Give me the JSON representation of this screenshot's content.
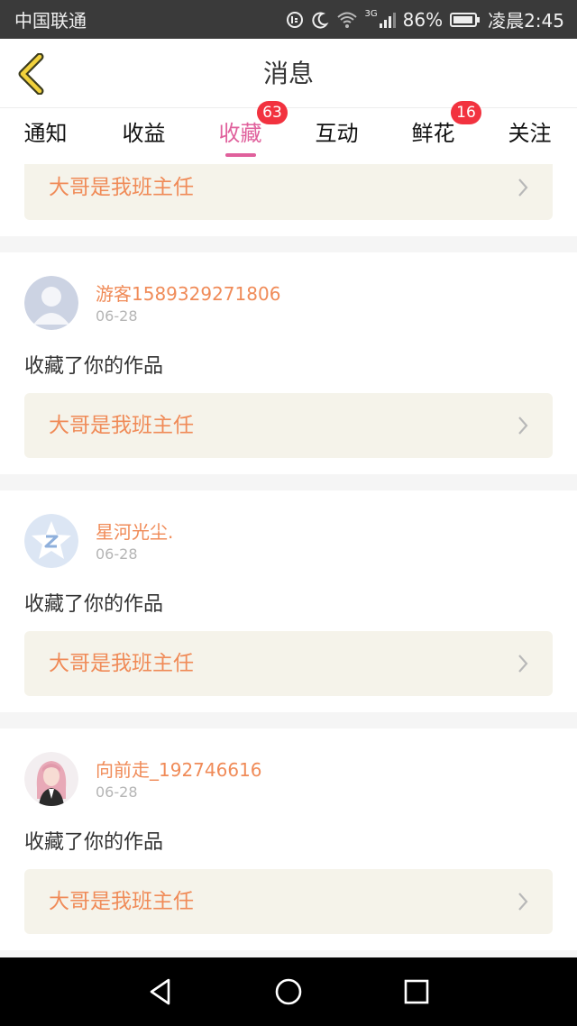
{
  "status_bar": {
    "carrier": "中国联通",
    "network": "3G",
    "battery": "86%",
    "time": "凌晨2:45"
  },
  "header": {
    "title": "消息"
  },
  "tabs": [
    {
      "label": "通知"
    },
    {
      "label": "收益"
    },
    {
      "label": "收藏",
      "badge": "63",
      "active": true
    },
    {
      "label": "互动"
    },
    {
      "label": "鲜花",
      "badge": "16"
    },
    {
      "label": "关注"
    }
  ],
  "first_card": {
    "work_title": "大哥是我班主任"
  },
  "messages": [
    {
      "username": "游客1589329271806",
      "date": "06-28",
      "action": "收藏了你的作品",
      "work_title": "大哥是我班主任",
      "avatar": "default-person-avatar"
    },
    {
      "username": "星河光尘.",
      "date": "06-28",
      "action": "收藏了你的作品",
      "work_title": "大哥是我班主任",
      "avatar": "qq-star-avatar"
    },
    {
      "username": "向前走_192746616",
      "date": "06-28",
      "action": "收藏了你的作品",
      "work_title": "大哥是我班主任",
      "avatar": "pink-hair-girl-avatar"
    }
  ],
  "colors": {
    "accent": "#e0609c",
    "username": "#f08b58",
    "badge": "#f2323f",
    "link_bg": "#f5f3ea"
  }
}
